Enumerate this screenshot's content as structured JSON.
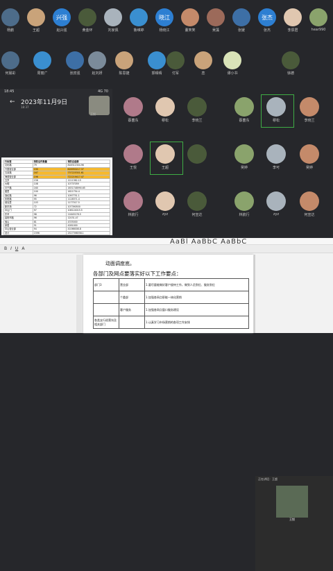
{
  "top_row": [
    "杨鹏",
    "王超",
    "赵兴强",
    "黄金环",
    "刘家佩",
    "鲁维婷",
    "杨晓江",
    "董笑笑",
    "吴藻",
    "张媛",
    "张杰",
    "李辰君",
    "hear990"
  ],
  "top_row_text_avatars": {
    "兴强": "#2d7fd2",
    "晓江": "#2d7fd2",
    "张杰": "#2d7fd2"
  },
  "second_row": [
    "何晨彩",
    "周丽广",
    "张宾强",
    "赵刘妍",
    "陈思捷",
    "郭晴晴",
    "付军",
    "蕊",
    "谭小书",
    "徐德"
  ],
  "grid_row1": [
    "蔡菌东",
    "穆松",
    "李晓兰",
    "蔡菌东",
    "穆松",
    "李晓兰"
  ],
  "grid_row2": [
    "王悦",
    "王超",
    "",
    "吴婷",
    "李可",
    "吴婷"
  ],
  "grid_row3": [
    "林航行",
    "zyz",
    "何宣达",
    "林航行",
    "zyz",
    "何宣达"
  ],
  "phone": {
    "status_time": "18:45",
    "status_right": "4G 70",
    "date": "2023年11月9日",
    "time": "18:37",
    "presenter": "王悦",
    "sheet_headers": [
      "行标签",
      "预防证件数量",
      "预防总金额"
    ],
    "sheet_rows": [
      [
        "文化路",
        "79",
        "818311304.96"
      ],
      [
        "兴园营业部",
        "190",
        "626950217.37"
      ],
      [
        "五泉路",
        "167",
        "737225301.61"
      ],
      [
        "海德营业部",
        "196",
        "722219417.47"
      ],
      [
        "五岁",
        "156",
        "1211362.15"
      ],
      [
        "大明",
        "108",
        "10737059"
      ],
      [
        "贝宁路",
        "160",
        "1631748990.65"
      ],
      [
        "图里",
        "100",
        "1621754.4"
      ],
      [
        "涤纶路",
        "96",
        "1097751.1"
      ],
      [
        "庆阳路",
        "95",
        "1128371.4"
      ],
      [
        "德克里",
        "103",
        "1177017.5"
      ],
      [
        "新东滴",
        "72",
        "107390500"
      ],
      [
        "中山门",
        "97",
        "108124015.5"
      ],
      [
        "东辛",
        "98",
        "11645178.5"
      ],
      [
        "金阳市路",
        "96",
        "12031.47"
      ],
      [
        "宝山",
        "81",
        "4335000"
      ],
      [
        "家属",
        "51",
        "4281000"
      ],
      [
        "中山营业部",
        "94",
        "41066008.8"
      ],
      [
        "总计",
        "1596",
        "2527398558.1"
      ]
    ]
  },
  "doc": {
    "ribbon_text": "AaBl AaBbC AaBbC",
    "heading1": "动面调度底。",
    "heading2": "各部门及网点要落实好以下工作要点：",
    "rows": [
      [
        "部门3",
        "营业部",
        "1.要尽量能做好客户接待工作，做到人员到位、服务到位"
      ],
      [
        "",
        "个委部",
        "1.加强各网点职能一体化营销"
      ],
      [
        "",
        "客户服务",
        "1.加强各网点窗口服务建设"
      ],
      [
        "各类支行经营块及相关部门",
        "",
        "1.认真学习市场营销的各项工作安排"
      ]
    ]
  },
  "meeting": {
    "title": "正在讲话：王超",
    "speaker": "王悦"
  }
}
